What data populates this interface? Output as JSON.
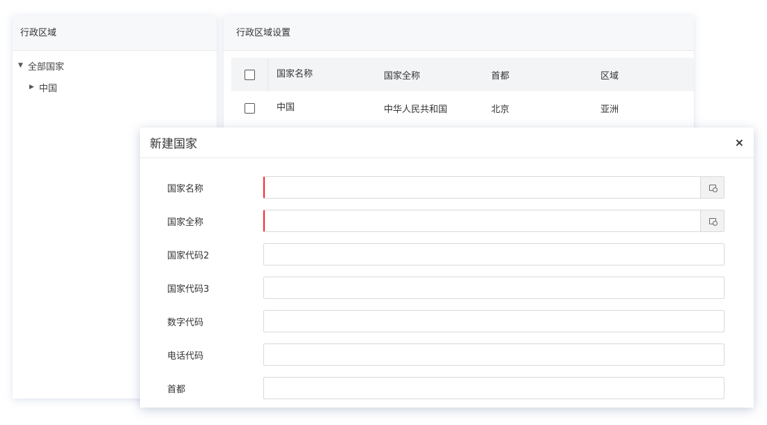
{
  "left_panel": {
    "title": "行政区域",
    "tree": [
      {
        "label": "全部国家",
        "expanded": true
      },
      {
        "label": "中国",
        "expanded": false
      }
    ]
  },
  "right_panel": {
    "title": "行政区域设置",
    "table": {
      "columns": [
        "国家名称",
        "国家全称",
        "首都",
        "区域"
      ],
      "rows": [
        [
          "中国",
          "中华人民共和国",
          "北京",
          "亚洲"
        ]
      ]
    }
  },
  "modal": {
    "title": "新建国家",
    "close_icon": "×",
    "fields": [
      {
        "label": "国家名称",
        "value": "",
        "required": true,
        "has_addon": true,
        "addon_icon": "translate-icon"
      },
      {
        "label": "国家全称",
        "value": "",
        "required": true,
        "has_addon": true,
        "addon_icon": "translate-icon"
      },
      {
        "label": "国家代码2",
        "value": ""
      },
      {
        "label": "国家代码3",
        "value": ""
      },
      {
        "label": "数字代码",
        "value": ""
      },
      {
        "label": "电话代码",
        "value": ""
      },
      {
        "label": "首都",
        "value": ""
      }
    ]
  },
  "colors": {
    "required_marker": "#f5222d",
    "header_bg": "#f7f8fa",
    "table_header_bg": "#f3f4f6"
  }
}
